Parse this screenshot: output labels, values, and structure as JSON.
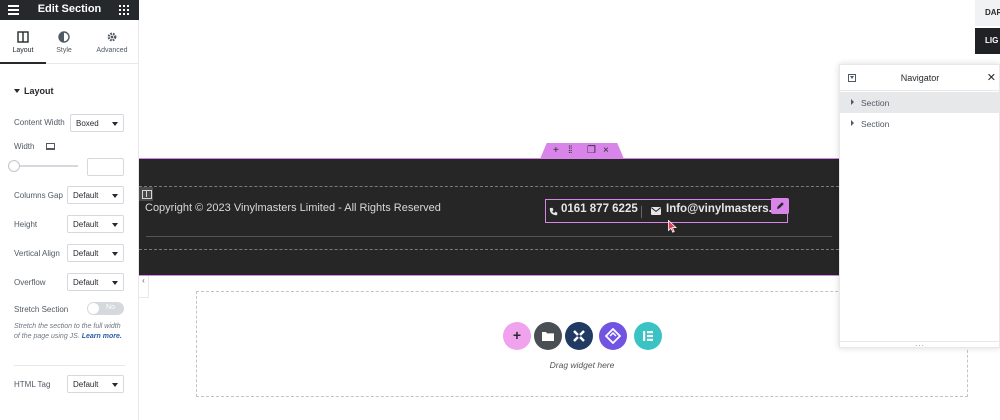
{
  "panel": {
    "title": "Edit Section",
    "tabs": [
      {
        "label": "Layout"
      },
      {
        "label": "Style"
      },
      {
        "label": "Advanced"
      }
    ],
    "section_title": "Layout",
    "controls": {
      "content_width": {
        "label": "Content Width",
        "value": "Boxed"
      },
      "width": {
        "label": "Width"
      },
      "columns_gap": {
        "label": "Columns Gap",
        "value": "Default"
      },
      "height": {
        "label": "Height",
        "value": "Default"
      },
      "vertical_align": {
        "label": "Vertical Align",
        "value": "Default"
      },
      "overflow": {
        "label": "Overflow",
        "value": "Default"
      },
      "stretch_section": {
        "label": "Stretch Section",
        "toggle": "No"
      },
      "help_text": "Stretch the section to the full width of the page using JS.",
      "learn_more": "Learn more.",
      "html_tag": {
        "label": "HTML Tag",
        "value": "Default"
      }
    }
  },
  "canvas": {
    "copyright": "Copyright © 2023 Vinylmasters Limited - All Rights Reserved",
    "phone": "0161 877 6225",
    "email": "Info@vinylmasters.co.uk",
    "drag_hint": "Drag widget here"
  },
  "navigator": {
    "title": "Navigator",
    "items": [
      {
        "label": "Section"
      },
      {
        "label": "Section"
      }
    ],
    "footer": "..."
  },
  "scheme_buttons": {
    "dark": "DAR",
    "light": "LIG"
  },
  "colors": {
    "accent": "#d884e9",
    "panel_header": "#26292c",
    "footer_bg": "#262626",
    "add_button": "#f0a3ec",
    "folder_button": "#4a4f54",
    "icon_button": "#213a64",
    "plugin_button": "#7155e2",
    "elementor_button": "#39c3c5"
  }
}
